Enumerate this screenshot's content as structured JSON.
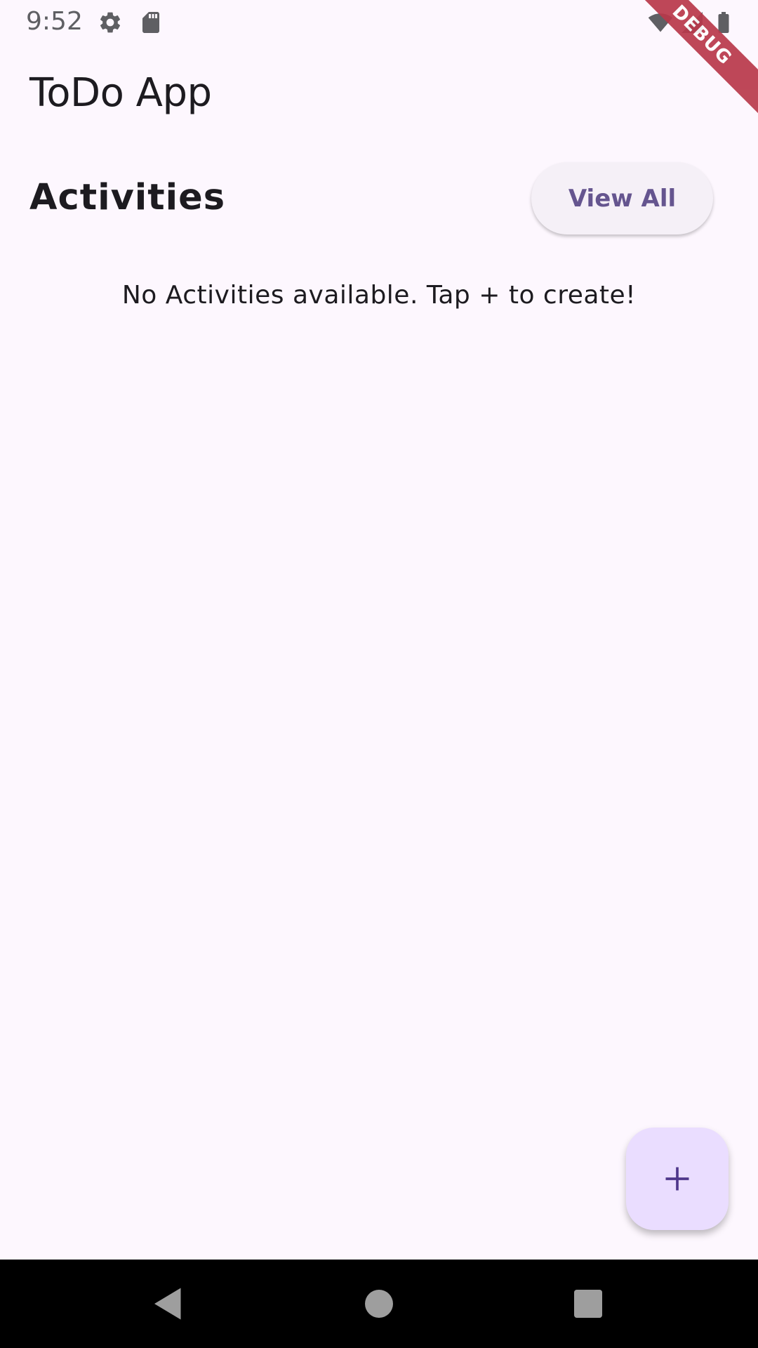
{
  "status_bar": {
    "time": "9:52",
    "icons": [
      "settings-icon",
      "sd-card-icon",
      "wifi-icon",
      "signal-icon",
      "battery-icon"
    ]
  },
  "debug_banner": {
    "label": "DEBUG"
  },
  "app_bar": {
    "title": "ToDo App"
  },
  "activities": {
    "heading": "Activities",
    "view_all_label": "View All",
    "empty_message": "No Activities available. Tap + to create!"
  },
  "fab": {
    "icon": "plus-icon"
  },
  "nav_bar": {
    "icons": [
      "back-icon",
      "home-icon",
      "recents-icon"
    ]
  },
  "colors": {
    "background": "#fdf7fe",
    "primary_text": "#1d1b20",
    "accent": "#65558f",
    "fab_background": "#eaddff",
    "debug_banner": "#b9394b"
  }
}
